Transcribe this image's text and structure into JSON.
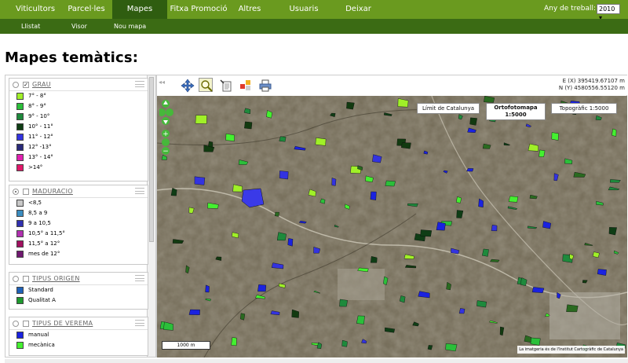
{
  "nav": {
    "items": [
      "Viticultors",
      "Parcel·les",
      "Mapes",
      "Fitxa Promoció",
      "Altres",
      "Usuaris",
      "Deixar sessió"
    ],
    "active": "Mapes",
    "year_label": "Any de treball:",
    "year_value": "2010 ▾"
  },
  "subnav": {
    "items": [
      "Llistat",
      "Visor",
      "Nou mapa"
    ]
  },
  "page_title": "Mapes temàtics:",
  "legend": {
    "layers": [
      {
        "title": "GRAU",
        "radio_selected": false,
        "checked": true,
        "items": [
          {
            "label": "7° - 8°",
            "color": "#a0f028"
          },
          {
            "label": "8° - 9°",
            "color": "#2bbf3a"
          },
          {
            "label": "9° - 10°",
            "color": "#1e8a3c"
          },
          {
            "label": "10° - 11°",
            "color": "#0f3d15"
          },
          {
            "label": "11° - 12°",
            "color": "#3333e0"
          },
          {
            "label": "12° -13°",
            "color": "#2a2a7a"
          },
          {
            "label": "13° - 14°",
            "color": "#e020b0"
          },
          {
            "label": ">14°",
            "color": "#e0186a"
          }
        ]
      },
      {
        "title": "MADURACIO",
        "radio_selected": true,
        "checked": false,
        "items": [
          {
            "label": "<8,5",
            "color": "#c8c8c8"
          },
          {
            "label": "8,5 a 9",
            "color": "#3a8cc0"
          },
          {
            "label": "9 a 10,5",
            "color": "#3030b0"
          },
          {
            "label": "10,5° a 11,5°",
            "color": "#b030b0"
          },
          {
            "label": "11,5° a 12°",
            "color": "#a01060"
          },
          {
            "label": "mes de 12°",
            "color": "#701870"
          }
        ]
      },
      {
        "title": "TIPUS ORIGEN",
        "radio_selected": false,
        "checked": false,
        "items": [
          {
            "label": "Standard",
            "color": "#1f62b8"
          },
          {
            "label": "Qualitat A",
            "color": "#1e9a2e"
          }
        ]
      },
      {
        "title": "TIPUS DE VEREMA",
        "radio_selected": false,
        "checked": false,
        "items": [
          {
            "label": "manual",
            "color": "#1a22e0"
          },
          {
            "label": "mecànica",
            "color": "#44f030"
          }
        ]
      }
    ]
  },
  "map": {
    "coords_e": "E (X)  395419.67107 m",
    "coords_n": "N (Y)  4580556.55120 m",
    "base_layers": {
      "limit": "Límit de Catalunya",
      "orto_title": "Ortofotomapa",
      "orto_scale": "1:5000",
      "topo": "Topogràfic 1:5000"
    },
    "scale_label": "1000 m",
    "attribution": "La imatgeria és de l'Institut Cartogràfic de Catalunya",
    "tools": [
      "pan-icon",
      "zoom-box-icon",
      "info-icon",
      "layers-icon",
      "print-icon"
    ]
  }
}
